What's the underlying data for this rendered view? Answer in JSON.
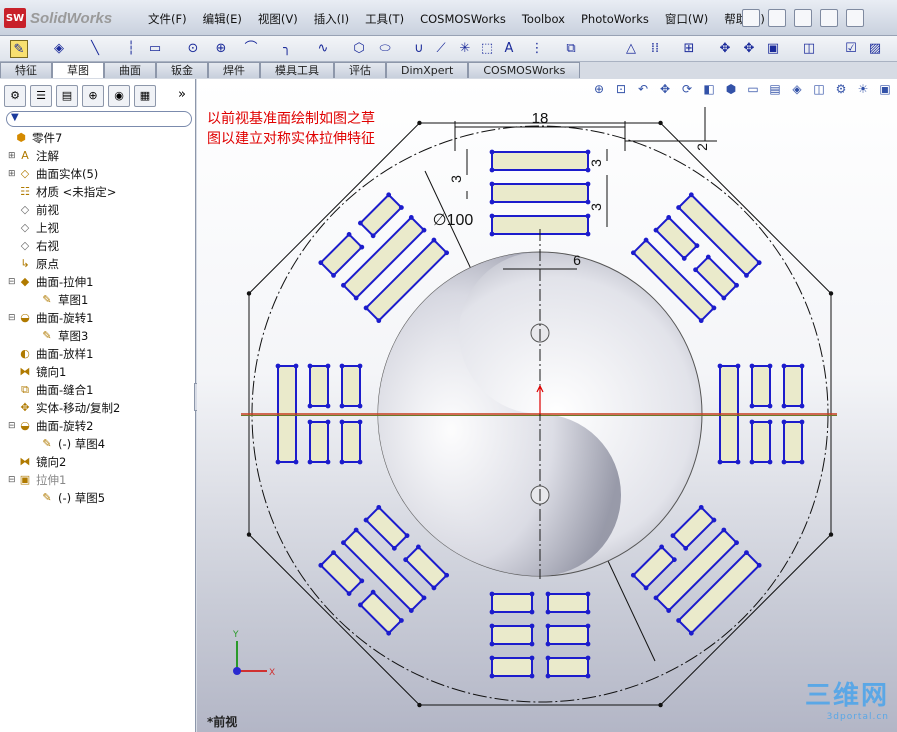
{
  "app": {
    "logo_mark": "SW",
    "logo_text": "SolidWorks"
  },
  "menus": [
    "文件(F)",
    "编辑(E)",
    "视图(V)",
    "插入(I)",
    "工具(T)",
    "COSMOSWorks",
    "Toolbox",
    "PhotoWorks",
    "窗口(W)",
    "帮助(H)"
  ],
  "tabs": [
    "特征",
    "草图",
    "曲面",
    "钣金",
    "焊件",
    "模具工具",
    "评估",
    "DimXpert",
    "COSMOSWorks"
  ],
  "active_tab": "草图",
  "panel": {
    "chevron": "»",
    "tree": [
      {
        "label": "零件7",
        "icon": "part-icon",
        "level": 0,
        "expand": ""
      },
      {
        "label": "注解",
        "icon": "annotation-icon",
        "level": 1,
        "expand": "+"
      },
      {
        "label": "曲面实体(5)",
        "icon": "surface-bodies-icon",
        "level": 1,
        "expand": "+"
      },
      {
        "label": "材质 <未指定>",
        "icon": "material-icon",
        "level": 1,
        "expand": ""
      },
      {
        "label": "前视",
        "icon": "plane-icon",
        "level": 1,
        "expand": ""
      },
      {
        "label": "上视",
        "icon": "plane-icon",
        "level": 1,
        "expand": ""
      },
      {
        "label": "右视",
        "icon": "plane-icon",
        "level": 1,
        "expand": ""
      },
      {
        "label": "原点",
        "icon": "origin-icon",
        "level": 1,
        "expand": ""
      },
      {
        "label": "曲面-拉伸1",
        "icon": "surface-extrude-icon",
        "level": 1,
        "expand": "-"
      },
      {
        "label": "草图1",
        "icon": "sketch-icon",
        "level": 2,
        "expand": ""
      },
      {
        "label": "曲面-旋转1",
        "icon": "surface-revolve-icon",
        "level": 1,
        "expand": "-"
      },
      {
        "label": "草图3",
        "icon": "sketch-icon",
        "level": 2,
        "expand": ""
      },
      {
        "label": "曲面-放样1",
        "icon": "surface-loft-icon",
        "level": 1,
        "expand": ""
      },
      {
        "label": "镜向1",
        "icon": "mirror-icon",
        "level": 1,
        "expand": ""
      },
      {
        "label": "曲面-缝合1",
        "icon": "surface-knit-icon",
        "level": 1,
        "expand": ""
      },
      {
        "label": "实体-移动/复制2",
        "icon": "move-copy-icon",
        "level": 1,
        "expand": ""
      },
      {
        "label": "曲面-旋转2",
        "icon": "surface-revolve-icon",
        "level": 1,
        "expand": "-"
      },
      {
        "label": "(-) 草图4",
        "icon": "sketch-icon",
        "level": 2,
        "expand": ""
      },
      {
        "label": "镜向2",
        "icon": "mirror-icon",
        "level": 1,
        "expand": ""
      },
      {
        "label": "拉伸1",
        "icon": "extrude-icon",
        "level": 1,
        "expand": "-",
        "suppressed": true
      },
      {
        "label": "(-) 草图5",
        "icon": "sketch-icon",
        "level": 2,
        "expand": ""
      }
    ]
  },
  "viewport": {
    "note": "以前视基准面绘制如图之草\n图以建立对称实体拉伸特征",
    "view_label": "*前视",
    "triad": {
      "x": "X",
      "y": "Y"
    },
    "dimensions": {
      "width": "18",
      "gap_top": "2",
      "bar_h1": "3",
      "bar_h2": "3",
      "bar_h3": "3",
      "break_w": "6",
      "diameter": "∅100"
    },
    "colors": {
      "sketch": "#1c1ccc",
      "fill": "#eaeacb",
      "dim": "#111111",
      "axis_x": "#c83c1e",
      "axis_y": "#6a7a2a",
      "annotation": "#e00000"
    }
  },
  "watermark": {
    "main": "三维网",
    "sub": "3dportal.cn"
  }
}
